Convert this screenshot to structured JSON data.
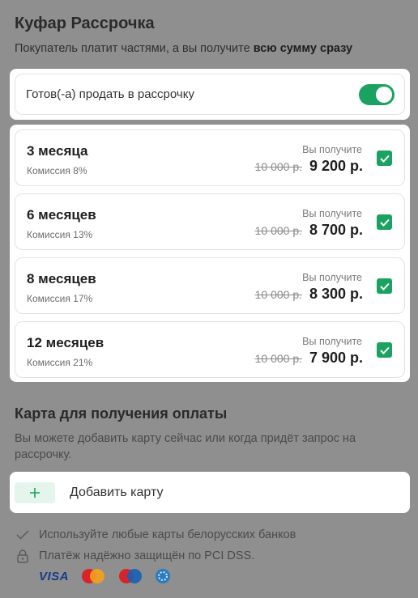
{
  "header": {
    "title": "Куфар Рассрочка",
    "subtitle_prefix": "Покупатель платит частями, а вы получите ",
    "subtitle_bold": "всю сумму сразу"
  },
  "toggle": {
    "label": "Готов(-а) продать в рассрочку",
    "enabled": true,
    "color": "#1aa260"
  },
  "plans": [
    {
      "name": "3 месяца",
      "fee": "Комиссия 8%",
      "receive_label": "Вы получите",
      "old_price": "10 000 р.",
      "new_price": "9 200 р.",
      "checked": true
    },
    {
      "name": "6 месяцев",
      "fee": "Комиссия 13%",
      "receive_label": "Вы получите",
      "old_price": "10 000 р.",
      "new_price": "8 700 р.",
      "checked": true
    },
    {
      "name": "8 месяцев",
      "fee": "Комиссия 17%",
      "receive_label": "Вы получите",
      "old_price": "10 000 р.",
      "new_price": "8 300 р.",
      "checked": true
    },
    {
      "name": "12 месяцев",
      "fee": "Комиссия 21%",
      "receive_label": "Вы получите",
      "old_price": "10 000 р.",
      "new_price": "7 900 р.",
      "checked": true
    }
  ],
  "card_section": {
    "title": "Карта для получения оплаты",
    "description": "Вы можете добавить карту сейчас или когда придёт запрос на рассрочку.",
    "add_button": "Добавить карту"
  },
  "info": {
    "banks": "Используйте любые карты белорусских банков",
    "security": "Платёж надёжно защищён по PCI DSS."
  },
  "payment_logos": {
    "visa": "VISA",
    "icons": [
      "mastercard-icon",
      "maestro-icon",
      "belcard-icon"
    ]
  },
  "colors": {
    "accent": "#1aa260",
    "overlay": "#8f8f8f"
  }
}
